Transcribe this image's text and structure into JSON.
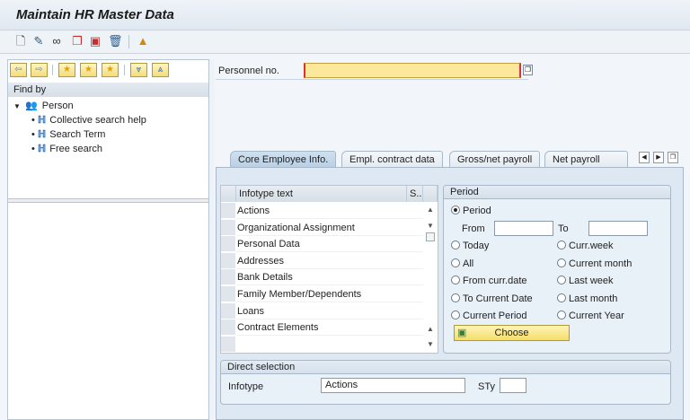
{
  "title": "Maintain HR Master Data",
  "toolbar": {
    "icons": [
      "create-icon",
      "change-icon",
      "display-icon",
      "copy-icon",
      "delimit-icon",
      "delete-icon",
      "overview-icon"
    ]
  },
  "navbar": {
    "icons": [
      "back-icon",
      "forward-icon",
      "add-favorite-icon",
      "favorites-icon",
      "delete-favorite-icon",
      "expand-icon",
      "collapse-icon"
    ]
  },
  "find_by": {
    "header": "Find by",
    "root": "Person",
    "items": [
      "Collective search help",
      "Search Term",
      "Free search"
    ]
  },
  "personnel": {
    "label": "Personnel no.",
    "value": ""
  },
  "tabs": [
    "Core Employee Info.",
    "Empl. contract data",
    "Gross/net payroll",
    "Net payroll"
  ],
  "table": {
    "headers": [
      "Infotype text",
      "S.."
    ],
    "rows": [
      "Actions",
      "Organizational Assignment",
      "Personal Data",
      "Addresses",
      "Bank Details",
      "Family Member/Dependents",
      "Loans",
      "Contract Elements"
    ]
  },
  "period": {
    "title": "Period",
    "period_label": "Period",
    "from_label": "From",
    "to_label": "To",
    "from_value": "",
    "to_value": "",
    "options_left": [
      "Today",
      "All",
      "From curr.date",
      "To Current Date",
      "Current Period"
    ],
    "options_right": [
      "Curr.week",
      "Current month",
      "Last week",
      "Last month",
      "Current Year"
    ],
    "choose_label": "Choose"
  },
  "direct": {
    "title": "Direct selection",
    "infotype_label": "Infotype",
    "infotype_value": "Actions",
    "sty_label": "STy",
    "sty_value": ""
  }
}
